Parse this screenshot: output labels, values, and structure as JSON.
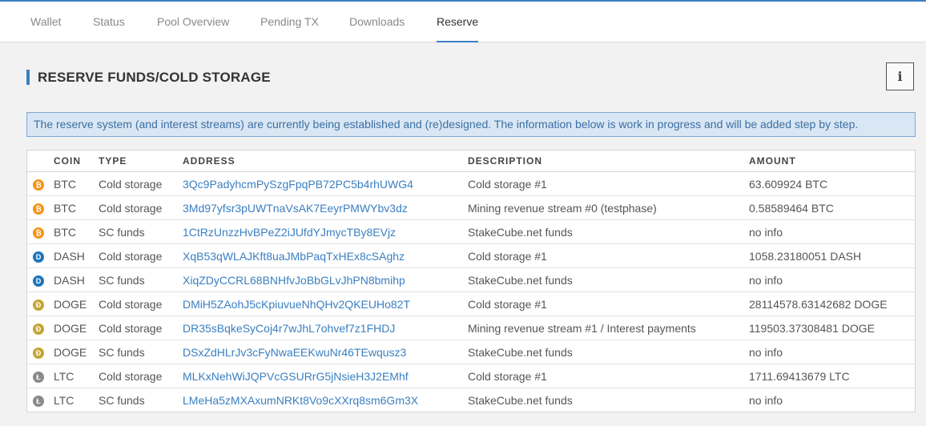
{
  "nav": {
    "tabs": [
      "Wallet",
      "Status",
      "Pool Overview",
      "Pending TX",
      "Downloads",
      "Reserve"
    ],
    "active": "Reserve"
  },
  "section": {
    "title": "RESERVE FUNDS/COLD STORAGE",
    "info_icon": "info-icon"
  },
  "notice": "The reserve system (and interest streams) are currently being established and (re)designed. The information below is work in progress and will be added step by step.",
  "table": {
    "headers": [
      "COIN",
      "TYPE",
      "ADDRESS",
      "DESCRIPTION",
      "AMOUNT"
    ],
    "rows": [
      {
        "coin": "BTC",
        "icon": "bitcoin-icon",
        "type": "Cold storage",
        "address": "3Qc9PadyhcmPySzgFpqPB72PC5b4rhUWG4",
        "description": "Cold storage #1",
        "amount": "63.609924 BTC"
      },
      {
        "coin": "BTC",
        "icon": "bitcoin-icon",
        "type": "Cold storage",
        "address": "3Md97yfsr3pUWTnaVsAK7EeyrPMWYbv3dz",
        "description": "Mining revenue stream #0 (testphase)",
        "amount": "0.58589464 BTC"
      },
      {
        "coin": "BTC",
        "icon": "bitcoin-icon",
        "type": "SC funds",
        "address": "1CtRzUnzzHvBPeZ2iJUfdYJmycTBy8EVjz",
        "description": "StakeCube.net funds",
        "amount": "no info"
      },
      {
        "coin": "DASH",
        "icon": "dash-icon",
        "type": "Cold storage",
        "address": "XqB53qWLAJKft8uaJMbPaqTxHEx8cSAghz",
        "description": "Cold storage #1",
        "amount": "1058.23180051 DASH"
      },
      {
        "coin": "DASH",
        "icon": "dash-icon",
        "type": "SC funds",
        "address": "XiqZDyCCRL68BNHfvJoBbGLvJhPN8bmihp",
        "description": "StakeCube.net funds",
        "amount": "no info"
      },
      {
        "coin": "DOGE",
        "icon": "dogecoin-icon",
        "type": "Cold storage",
        "address": "DMiH5ZAohJ5cKpiuvueNhQHv2QKEUHo82T",
        "description": "Cold storage #1",
        "amount": "28114578.63142682 DOGE"
      },
      {
        "coin": "DOGE",
        "icon": "dogecoin-icon",
        "type": "Cold storage",
        "address": "DR35sBqkeSyCoj4r7wJhL7ohvef7z1FHDJ",
        "description": "Mining revenue stream #1 / Interest payments",
        "amount": "119503.37308481 DOGE"
      },
      {
        "coin": "DOGE",
        "icon": "dogecoin-icon",
        "type": "SC funds",
        "address": "DSxZdHLrJv3cFyNwaEEKwuNr46TEwqusz3",
        "description": "StakeCube.net funds",
        "amount": "no info"
      },
      {
        "coin": "LTC",
        "icon": "litecoin-icon",
        "type": "Cold storage",
        "address": "MLKxNehWiJQPVcGSURrG5jNsieH3J2EMhf",
        "description": "Cold storage #1",
        "amount": "1711.69413679 LTC"
      },
      {
        "coin": "LTC",
        "icon": "litecoin-icon",
        "type": "SC funds",
        "address": "LMeHa5zMXAxumNRKt8Vo9cXXrq8sm6Gm3X",
        "description": "StakeCube.net funds",
        "amount": "no info"
      }
    ]
  },
  "colors": {
    "accent": "#3a7fc1",
    "bitcoin": "#f7931a",
    "dash": "#1c75bc",
    "dogecoin": "#c2a633",
    "litecoin": "#8a8a8a"
  }
}
